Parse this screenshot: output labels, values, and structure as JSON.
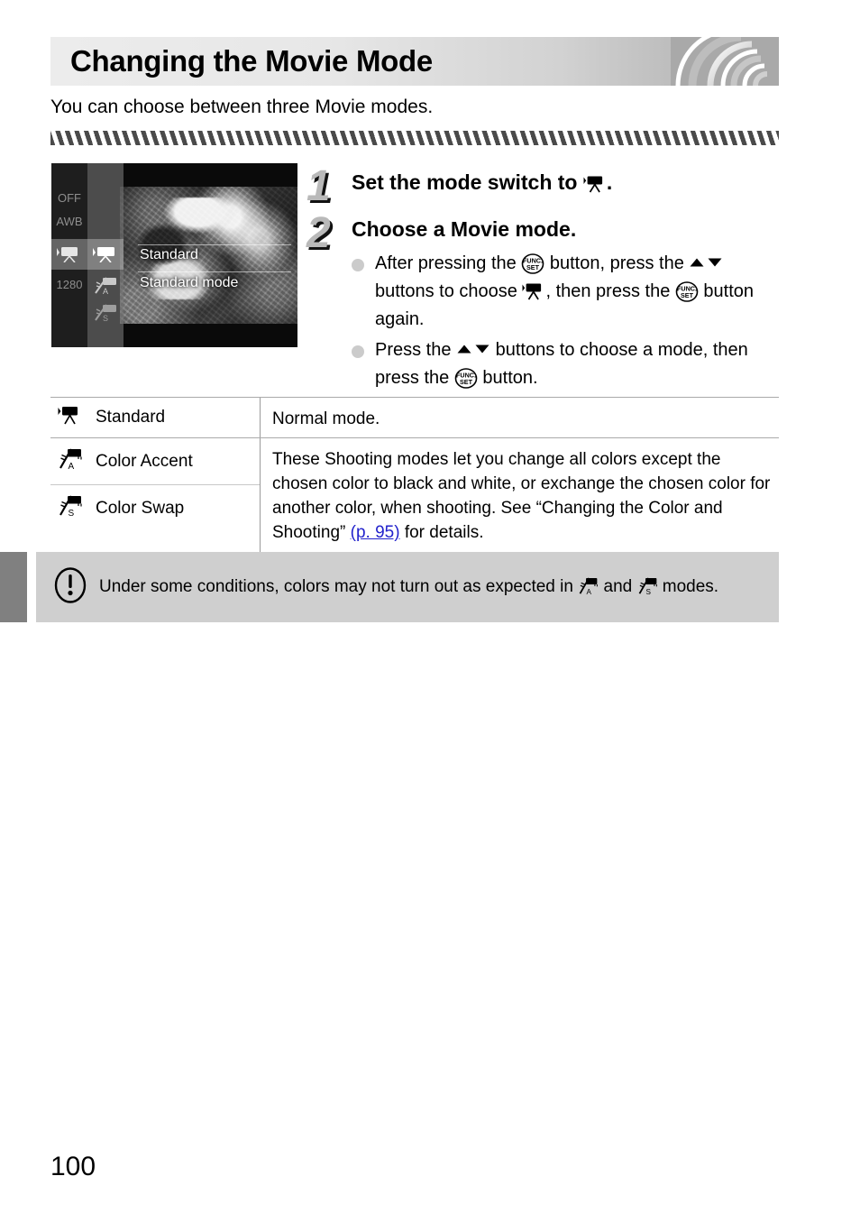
{
  "header": {
    "title": "Changing the Movie Mode",
    "decoration": "concentric-arcs"
  },
  "intro": "You can choose between three Movie modes.",
  "screenshot": {
    "func_menu_left": [
      "OFF",
      "AWB",
      "movie-camera-icon",
      "1280"
    ],
    "func_menu_right": [
      "movie-standard-icon",
      "color-accent-icon",
      "color-swap-icon"
    ],
    "selected_label": "Standard",
    "selected_description": "Standard mode"
  },
  "steps": [
    {
      "number": "1",
      "heading_before": "Set the mode switch to ",
      "heading_icon": "movie-camera-icon",
      "heading_after": ".",
      "bullets": []
    },
    {
      "number": "2",
      "heading_before": "Choose a Movie mode.",
      "heading_icon": "",
      "heading_after": "",
      "bullets": [
        {
          "p1": "After pressing the ",
          "i1": "func-set-icon",
          "p2": " button, press the ",
          "i2": "up-down-buttons-icon",
          "p3": " buttons to choose ",
          "i3": "movie-camera-icon",
          "p4": ", then press the ",
          "i4": "func-set-icon",
          "p5": " button again."
        },
        {
          "p1": "Press the ",
          "i1": "up-down-buttons-icon",
          "p2": " buttons to choose a mode, then press the ",
          "i2": "func-set-icon",
          "p3": " button.",
          "i3": "",
          "p4": "",
          "i4": "",
          "p5": ""
        }
      ]
    }
  ],
  "table": {
    "rows": [
      {
        "icon": "movie-standard-icon",
        "label": "Standard"
      },
      {
        "icon": "color-accent-icon",
        "label": "Color Accent"
      },
      {
        "icon": "color-swap-icon",
        "label": "Color Swap"
      }
    ],
    "desc_standard": "Normal mode.",
    "desc_color_before": "These Shooting modes let you change all colors except the chosen color to black and white, or exchange the chosen color for another color, when shooting. See “Changing the Color and Shooting” ",
    "desc_color_link": "(p. 95)",
    "desc_color_after": " for details."
  },
  "note": {
    "icon": "exclamation-circle-icon",
    "text_before": "Under some conditions, colors may not turn out as expected in ",
    "icon1": "color-accent-icon",
    "text_mid": " and ",
    "icon2": "color-swap-icon",
    "text_after": " modes."
  },
  "page_number": "100",
  "colors": {
    "link": "#2222cc",
    "edge_tab": "#808080",
    "note_bg": "#cfcfcf",
    "hatch": "#4a4a4a",
    "step_number": "#b9b9b9"
  }
}
